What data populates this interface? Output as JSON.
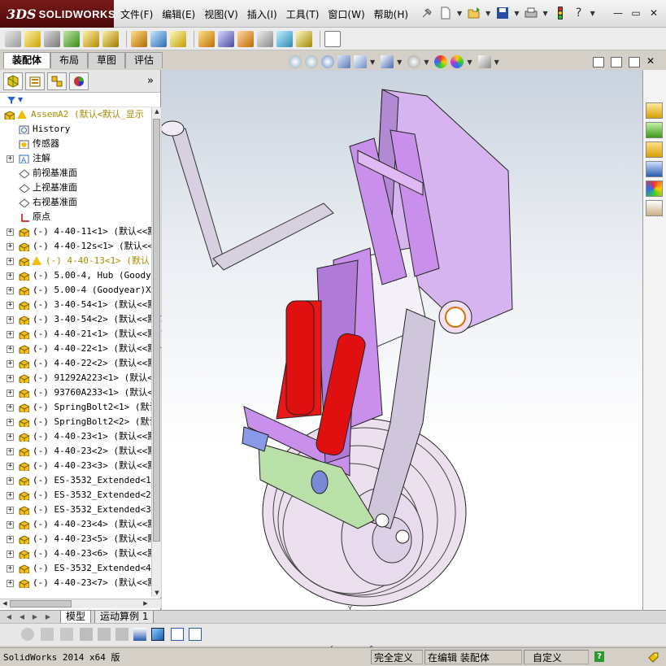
{
  "app": {
    "brand_prefix": "3DS",
    "brand_name": "SOLIDWORKS",
    "menus": [
      "文件(F)",
      "编辑(E)",
      "视图(V)",
      "插入(I)",
      "工具(T)",
      "窗口(W)",
      "帮助(H)"
    ],
    "window_controls": [
      "—",
      "▭",
      "✕"
    ]
  },
  "command_manager": {
    "tabs": [
      "装配体",
      "布局",
      "草图",
      "评估"
    ],
    "active_tab": "装配体"
  },
  "feature_manager": {
    "panel_tabs": [
      "feature-tree-icon",
      "property-manager-icon",
      "configuration-manager-icon",
      "appearance-icon"
    ],
    "more": "»",
    "filter_icon": "funnel-icon",
    "tree": [
      {
        "label": "AssemA2  (默认<默认_显示",
        "icon": "assembly-icon",
        "warn": true,
        "root": true
      },
      {
        "label": "History",
        "icon": "history-icon"
      },
      {
        "label": "传感器",
        "icon": "sensor-icon"
      },
      {
        "label": "注解",
        "icon": "annotation-icon",
        "expand": true
      },
      {
        "label": "前视基准面",
        "icon": "plane-icon"
      },
      {
        "label": "上视基准面",
        "icon": "plane-icon"
      },
      {
        "label": "右视基准面",
        "icon": "plane-icon"
      },
      {
        "label": "原点",
        "icon": "origin-icon"
      },
      {
        "label": "(-) 4-40-11<1> (默认<<默",
        "icon": "part-icon",
        "expand": true
      },
      {
        "label": "(-) 4-40-12s<1> (默认<<",
        "icon": "part-icon",
        "expand": true
      },
      {
        "label": "(-) 4-40-13<1> (默认",
        "icon": "part-icon",
        "expand": true,
        "warn": true,
        "warntext": true
      },
      {
        "label": "(-) 5.00-4, Hub (Goodye",
        "icon": "part-icon",
        "expand": true
      },
      {
        "label": "(-) 5.00-4 (Goodyear)X<",
        "icon": "part-icon",
        "expand": true
      },
      {
        "label": "(-) 3-40-54<1> (默认<<默",
        "icon": "part-icon",
        "expand": true
      },
      {
        "label": "(-) 3-40-54<2> (默认<<默",
        "icon": "part-icon",
        "expand": true
      },
      {
        "label": "(-) 4-40-21<1> (默认<<默",
        "icon": "part-icon",
        "expand": true
      },
      {
        "label": "(-) 4-40-22<1> (默认<<默",
        "icon": "part-icon",
        "expand": true
      },
      {
        "label": "(-) 4-40-22<2> (默认<<默",
        "icon": "part-icon",
        "expand": true
      },
      {
        "label": "(-) 91292A223<1> (默认<",
        "icon": "part-icon",
        "expand": true
      },
      {
        "label": "(-) 93760A233<1> (默认<",
        "icon": "part-icon",
        "expand": true
      },
      {
        "label": "(-) SpringBolt2<1> (默认",
        "icon": "part-icon",
        "expand": true
      },
      {
        "label": "(-) SpringBolt2<2> (默认",
        "icon": "part-icon",
        "expand": true
      },
      {
        "label": "(-) 4-40-23<1> (默认<<默",
        "icon": "part-icon",
        "expand": true
      },
      {
        "label": "(-) 4-40-23<2> (默认<<默",
        "icon": "part-icon",
        "expand": true
      },
      {
        "label": "(-) 4-40-23<3> (默认<<默",
        "icon": "part-icon",
        "expand": true
      },
      {
        "label": "(-) ES-3532_Extended<1>",
        "icon": "part-icon",
        "expand": true
      },
      {
        "label": "(-) ES-3532_Extended<2>",
        "icon": "part-icon",
        "expand": true
      },
      {
        "label": "(-) ES-3532_Extended<3>",
        "icon": "part-icon",
        "expand": true
      },
      {
        "label": "(-) 4-40-23<4> (默认<<默",
        "icon": "part-icon",
        "expand": true
      },
      {
        "label": "(-) 4-40-23<5> (默认<<默",
        "icon": "part-icon",
        "expand": true
      },
      {
        "label": "(-) 4-40-23<6> (默认<<默",
        "icon": "part-icon",
        "expand": true
      },
      {
        "label": "(-) ES-3532_Extended<4>",
        "icon": "part-icon",
        "expand": true
      },
      {
        "label": "(-) 4-40-23<7> (默认<<默",
        "icon": "part-icon",
        "expand": true
      }
    ]
  },
  "bottom_tabs": [
    "模型",
    "运动算例 1"
  ],
  "statusbar": {
    "app_version": "SolidWorks 2014 x64 版",
    "definition": "完全定义",
    "editing": "在编辑 装配体",
    "units": "自定义",
    "help": "?"
  },
  "colors": {
    "accent_red": "#7a1a1a",
    "model_purple": "#c9a4e6",
    "spring_red": "#e01010",
    "hub_green": "#b8e0a8"
  }
}
